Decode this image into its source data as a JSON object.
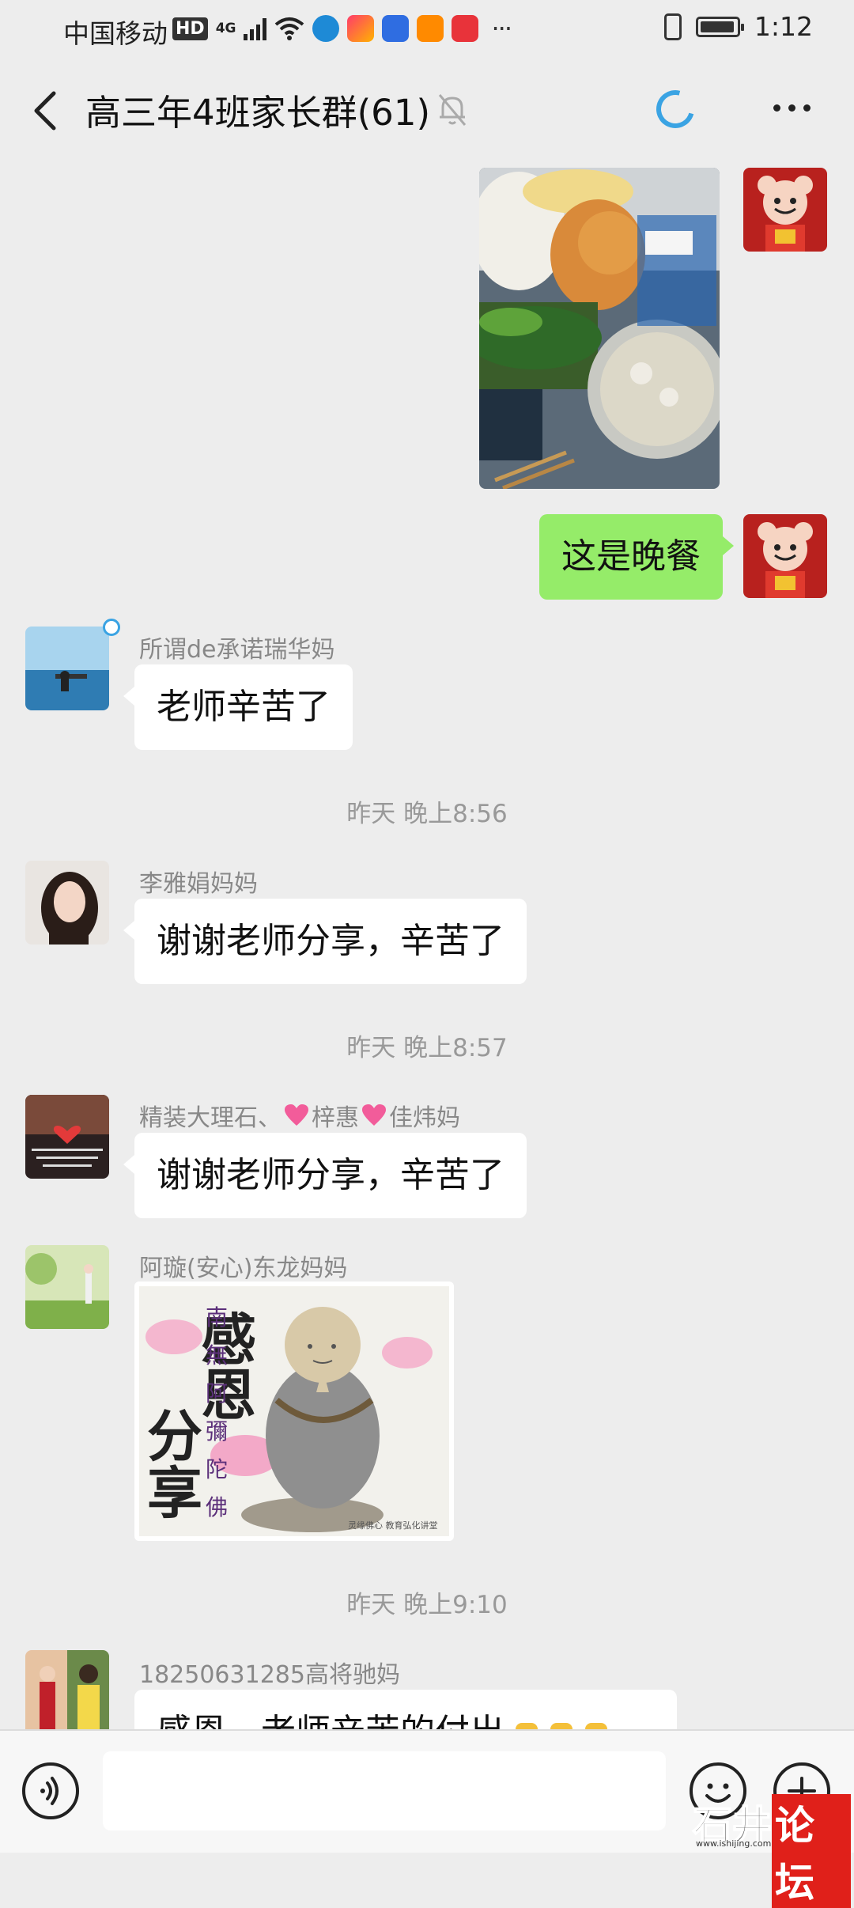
{
  "status_bar": {
    "carrier": "中国移动",
    "hd": "HD",
    "network": "4G",
    "more": "···",
    "time": "1:12"
  },
  "header": {
    "title": "高三年4班家长群(61)",
    "back_icon": "chevron-left-icon",
    "mute_icon": "bell-off-icon",
    "menu_icon": "more-horizontal-icon",
    "loading_icon": "loading-spinner-icon"
  },
  "messages": {
    "m1": {
      "type": "image",
      "direction": "outgoing",
      "content": "photo of a boxed dinner: rice, fried chicken, greens, soup"
    },
    "m2": {
      "type": "text",
      "direction": "outgoing",
      "text": "这是晚餐"
    },
    "m3": {
      "type": "text",
      "direction": "incoming",
      "sender": "所谓de承诺瑞华妈",
      "text": "老师辛苦了"
    },
    "t1": "昨天 晚上8:56",
    "m4": {
      "type": "text",
      "direction": "incoming",
      "sender": "李雅娟妈妈",
      "text": "谢谢老师分享，辛苦了"
    },
    "t2": "昨天 晚上8:57",
    "m5": {
      "type": "text",
      "direction": "incoming",
      "sender_part1": "精装大理石、",
      "sender_part2": "梓惠",
      "sender_part3": "佳炜妈",
      "text": "谢谢老师分享，辛苦了"
    },
    "m6": {
      "type": "sticker",
      "direction": "incoming",
      "sender": "阿璇(安心)东龙妈妈",
      "big_chars": [
        "感",
        "恩",
        "分",
        "享"
      ],
      "vertical_chars": [
        "南",
        "無",
        "阿",
        "彌",
        "陀",
        "佛"
      ],
      "credit": "灵缘佛心 教育弘化讲堂"
    },
    "t3": "昨天 晚上9:10",
    "m7": {
      "type": "text",
      "direction": "incoming",
      "sender": "18250631285高将驰妈",
      "text": "感恩，老师辛苦的付出"
    }
  },
  "input_bar": {
    "placeholder": "",
    "voice_icon": "voice-icon",
    "emoji_icon": "emoji-icon",
    "plus_icon": "plus-icon"
  },
  "watermark": {
    "part1": "石井",
    "part2": "论坛",
    "url": "www.ishijing.com"
  },
  "colors": {
    "background": "#ededed",
    "outgoing_bubble": "#95ec69",
    "incoming_bubble": "#ffffff",
    "accent_spinner": "#3aa3e3"
  }
}
